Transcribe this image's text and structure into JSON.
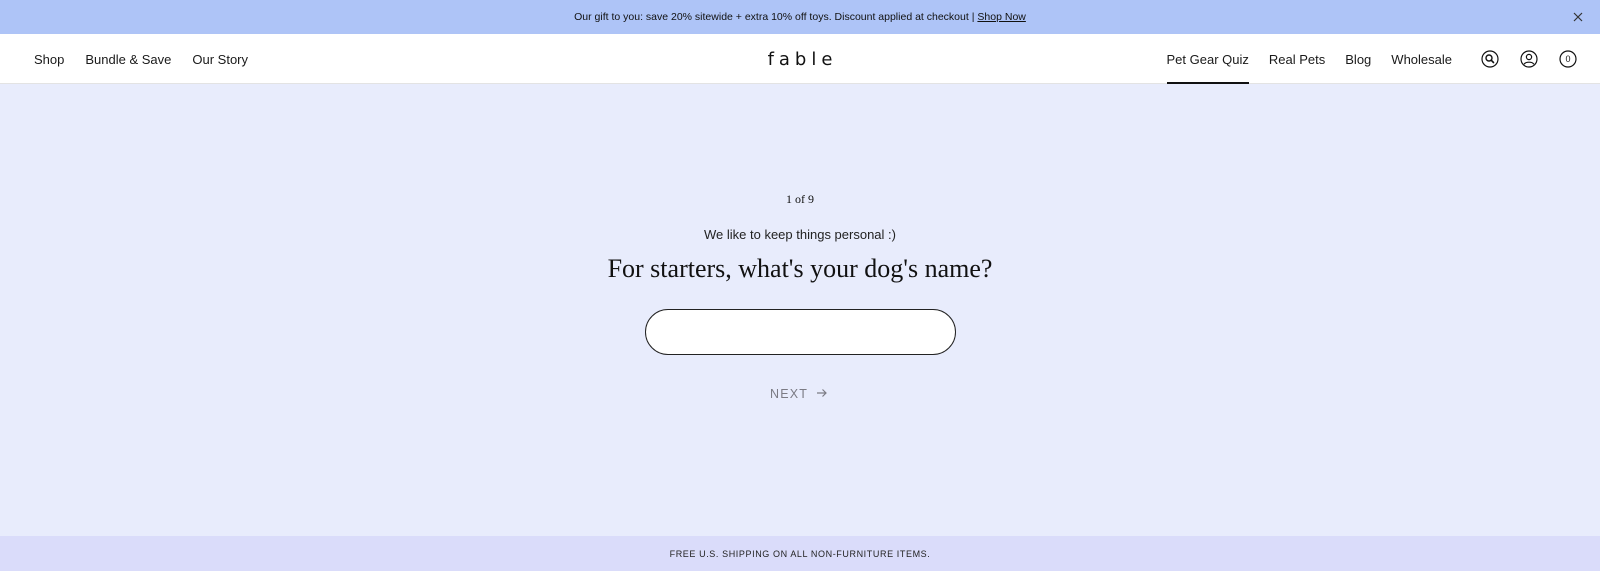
{
  "announcement": {
    "text": "Our gift to you: save 20% sitewide + extra 10% off toys. Discount applied at checkout |",
    "link": "Shop Now",
    "close_icon": "close-icon"
  },
  "header": {
    "logo": "fable",
    "left_nav": [
      "Shop",
      "Bundle & Save",
      "Our Story"
    ],
    "right_nav": [
      "Pet Gear Quiz",
      "Real Pets",
      "Blog",
      "Wholesale"
    ],
    "active_item": "Pet Gear Quiz",
    "icons": [
      "search-icon",
      "account-icon",
      "cart-icon"
    ],
    "cart_count": "0"
  },
  "quiz": {
    "step": "1 of 9",
    "subtitle": "We like to keep things personal :)",
    "question": "For starters, what's your dog's name?",
    "input_value": "",
    "input_placeholder": "",
    "next_label": "NEXT",
    "next_icon": "arrow-right-icon"
  },
  "footer": {
    "text": "FREE U.S. SHIPPING ON ALL NON-FURNITURE ITEMS."
  },
  "colors": {
    "announcement_bg": "#aec4f7",
    "page_bg": "#e8ecfc",
    "footer_bg": "#dadcfa",
    "next_text": "#7b7b84"
  }
}
